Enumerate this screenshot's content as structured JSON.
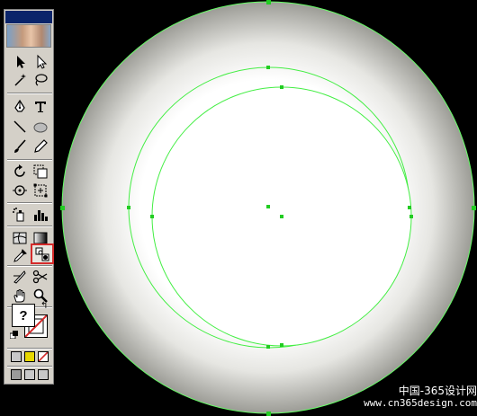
{
  "canvas": {
    "background": "#000000",
    "selection_color": "#66ff66",
    "shape_gradient": [
      "#ffffff",
      "#ffffff",
      "#9e9e98"
    ],
    "shapes": [
      "outer-radial-gradient-circle",
      "inner-circle-a",
      "inner-circle-b"
    ]
  },
  "toolbox": {
    "panel_color": "#d4d0c8",
    "titlebar_color": "#0a246a",
    "selected_tool": "gradient-mesh-tool",
    "tools": [
      [
        "selection-tool",
        "direct-selection-tool"
      ],
      [
        "magic-wand-tool",
        "lasso-tool"
      ],
      [
        "pen-tool",
        "type-tool"
      ],
      [
        "line-segment-tool",
        "ellipse-tool"
      ],
      [
        "paintbrush-tool",
        "pencil-tool"
      ],
      [
        "rotate-tool",
        "scale-tool"
      ],
      [
        "warp-tool",
        "free-transform-tool"
      ],
      [
        "symbol-sprayer-tool",
        "column-graph-tool"
      ],
      [
        "mesh-tool",
        "gradient-tool"
      ],
      [
        "eyedropper-tool",
        "blend-tool"
      ],
      [
        "slice-tool",
        "scissors-tool"
      ],
      [
        "hand-tool",
        "zoom-tool"
      ]
    ],
    "fill_stroke": {
      "fill_symbol": "?",
      "swap_symbol": "↰"
    },
    "color_modes": [
      "color",
      "gradient",
      "none"
    ],
    "screen_modes": [
      "standard-screen-mode",
      "full-screen-with-menu",
      "full-screen"
    ]
  },
  "watermark": {
    "line1": "中国-365设计网",
    "line2": "www.cn365design.com"
  }
}
